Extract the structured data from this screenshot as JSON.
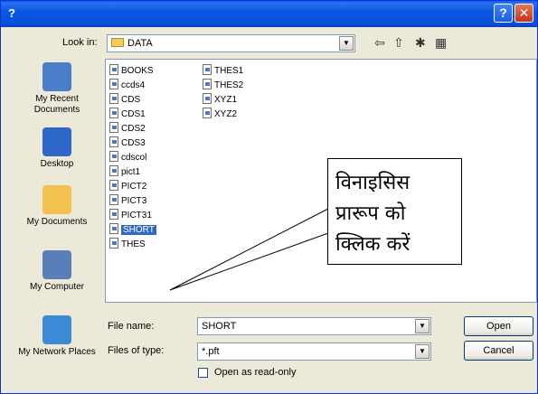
{
  "window": {
    "title": "?",
    "help_label": "?",
    "close_label": "✕"
  },
  "look_in": {
    "label": "Look in:",
    "value": "DATA"
  },
  "places": [
    {
      "label": "My Recent Documents",
      "icon": "recent-documents-icon",
      "color": "#4a7dc9"
    },
    {
      "label": "Desktop",
      "icon": "desktop-icon",
      "color": "#2c67c9"
    },
    {
      "label": "My Documents",
      "icon": "my-documents-icon",
      "color": "#f2c14e"
    },
    {
      "label": "My Computer",
      "icon": "my-computer-icon",
      "color": "#5a7fb8"
    },
    {
      "label": "My Network Places",
      "icon": "network-places-icon",
      "color": "#3a8ad6"
    }
  ],
  "files_col1": [
    "BOOKS",
    "ccds4",
    "CDS",
    "CDS1",
    "CDS2",
    "CDS3",
    "cdscol",
    "pict1",
    "PICT2",
    "PICT3",
    "PICT31",
    "SHORT",
    "THES"
  ],
  "files_col2": [
    "THES1",
    "THES2",
    "XYZ1",
    "XYZ2"
  ],
  "selected_file": "SHORT",
  "file_name": {
    "label": "File name:",
    "value": "SHORT"
  },
  "file_type": {
    "label": "Files of type:",
    "value": "*.pft"
  },
  "readonly": {
    "label": "Open as read-only"
  },
  "buttons": {
    "open": "Open",
    "cancel": "Cancel"
  },
  "callout": {
    "line1": "विनाइसिस",
    "line2": "प्रारूप को",
    "line3": "क्लिक करें"
  },
  "colors": {
    "titlebar": "#0a57e5",
    "selection": "#316ac5",
    "dialog_bg": "#ece9d8"
  }
}
